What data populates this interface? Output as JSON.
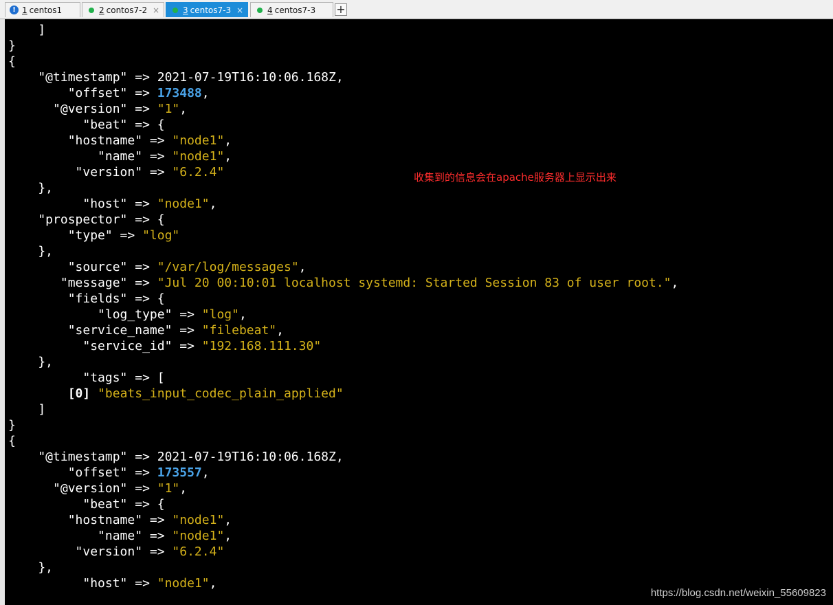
{
  "tabs": [
    {
      "num": "1",
      "label": "centos1",
      "status": "info",
      "active": false
    },
    {
      "num": "2",
      "label": "contos7-2",
      "status": "green-dot",
      "active": false
    },
    {
      "num": "3",
      "label": "centos7-3",
      "status": "green-dot",
      "active": true
    },
    {
      "num": "4",
      "label": "centos7-3",
      "status": "green-dot",
      "active": false
    }
  ],
  "tab_icons": {
    "info": "!",
    "close": "×",
    "new_tab": "+"
  },
  "colors": {
    "terminal_bg": "#000000",
    "text": "#ffffff",
    "string": "#d5b21a",
    "number": "#4aa3e8",
    "active_tab": "#1c8cd9",
    "connected_dot": "#22b14c",
    "annotation": "#ff2d2d"
  },
  "terminal": {
    "lines": [
      [
        {
          "t": "    ]",
          "c": "p"
        }
      ],
      [
        {
          "t": "}",
          "c": "p"
        }
      ],
      [
        {
          "t": "{",
          "c": "p"
        }
      ],
      [
        {
          "t": "    \"@timestamp\" => 2021-07-19T16:10:06.168Z,",
          "c": "p"
        }
      ],
      [
        {
          "t": "        \"offset\" => ",
          "c": "p"
        },
        {
          "t": "173488",
          "c": "n"
        },
        {
          "t": ",",
          "c": "p"
        }
      ],
      [
        {
          "t": "      \"@version\" => ",
          "c": "p"
        },
        {
          "t": "\"1\"",
          "c": "s"
        },
        {
          "t": ",",
          "c": "p"
        }
      ],
      [
        {
          "t": "          \"beat\" => {",
          "c": "p"
        }
      ],
      [
        {
          "t": "        \"hostname\" => ",
          "c": "p"
        },
        {
          "t": "\"node1\"",
          "c": "s"
        },
        {
          "t": ",",
          "c": "p"
        }
      ],
      [
        {
          "t": "            \"name\" => ",
          "c": "p"
        },
        {
          "t": "\"node1\"",
          "c": "s"
        },
        {
          "t": ",",
          "c": "p"
        }
      ],
      [
        {
          "t": "         \"version\" => ",
          "c": "p"
        },
        {
          "t": "\"6.2.4\"",
          "c": "s"
        }
      ],
      [
        {
          "t": "    },",
          "c": "p"
        }
      ],
      [
        {
          "t": "          \"host\" => ",
          "c": "p"
        },
        {
          "t": "\"node1\"",
          "c": "s"
        },
        {
          "t": ",",
          "c": "p"
        }
      ],
      [
        {
          "t": "    \"prospector\" => {",
          "c": "p"
        }
      ],
      [
        {
          "t": "        \"type\" => ",
          "c": "p"
        },
        {
          "t": "\"log\"",
          "c": "s"
        }
      ],
      [
        {
          "t": "    },",
          "c": "p"
        }
      ],
      [
        {
          "t": "        \"source\" => ",
          "c": "p"
        },
        {
          "t": "\"/var/log/messages\"",
          "c": "s"
        },
        {
          "t": ",",
          "c": "p"
        }
      ],
      [
        {
          "t": "       \"message\" => ",
          "c": "p"
        },
        {
          "t": "\"Jul 20 00:10:01 localhost systemd: Started Session 83 of user root.\"",
          "c": "s"
        },
        {
          "t": ",",
          "c": "p"
        }
      ],
      [
        {
          "t": "        \"fields\" => {",
          "c": "p"
        }
      ],
      [
        {
          "t": "            \"log_type\" => ",
          "c": "p"
        },
        {
          "t": "\"log\"",
          "c": "s"
        },
        {
          "t": ",",
          "c": "p"
        }
      ],
      [
        {
          "t": "        \"service_name\" => ",
          "c": "p"
        },
        {
          "t": "\"filebeat\"",
          "c": "s"
        },
        {
          "t": ",",
          "c": "p"
        }
      ],
      [
        {
          "t": "          \"service_id\" => ",
          "c": "p"
        },
        {
          "t": "\"192.168.111.30\"",
          "c": "s"
        }
      ],
      [
        {
          "t": "    },",
          "c": "p"
        }
      ],
      [
        {
          "t": "          \"tags\" => [",
          "c": "p"
        }
      ],
      [
        {
          "t": "        ",
          "c": "p"
        },
        {
          "t": "[0]",
          "c": "b"
        },
        {
          "t": " ",
          "c": "p"
        },
        {
          "t": "\"beats_input_codec_plain_applied\"",
          "c": "s"
        }
      ],
      [
        {
          "t": "    ]",
          "c": "p"
        }
      ],
      [
        {
          "t": "}",
          "c": "p"
        }
      ],
      [
        {
          "t": "{",
          "c": "p"
        }
      ],
      [
        {
          "t": "    \"@timestamp\" => 2021-07-19T16:10:06.168Z,",
          "c": "p"
        }
      ],
      [
        {
          "t": "        \"offset\" => ",
          "c": "p"
        },
        {
          "t": "173557",
          "c": "n"
        },
        {
          "t": ",",
          "c": "p"
        }
      ],
      [
        {
          "t": "      \"@version\" => ",
          "c": "p"
        },
        {
          "t": "\"1\"",
          "c": "s"
        },
        {
          "t": ",",
          "c": "p"
        }
      ],
      [
        {
          "t": "          \"beat\" => {",
          "c": "p"
        }
      ],
      [
        {
          "t": "        \"hostname\" => ",
          "c": "p"
        },
        {
          "t": "\"node1\"",
          "c": "s"
        },
        {
          "t": ",",
          "c": "p"
        }
      ],
      [
        {
          "t": "            \"name\" => ",
          "c": "p"
        },
        {
          "t": "\"node1\"",
          "c": "s"
        },
        {
          "t": ",",
          "c": "p"
        }
      ],
      [
        {
          "t": "         \"version\" => ",
          "c": "p"
        },
        {
          "t": "\"6.2.4\"",
          "c": "s"
        }
      ],
      [
        {
          "t": "    },",
          "c": "p"
        }
      ],
      [
        {
          "t": "          \"host\" => ",
          "c": "p"
        },
        {
          "t": "\"node1\"",
          "c": "s"
        },
        {
          "t": ",",
          "c": "p"
        }
      ]
    ]
  },
  "annotation": "收集到的信息会在apache服务器上显示出来",
  "watermark": "https://blog.csdn.net/weixin_55609823"
}
